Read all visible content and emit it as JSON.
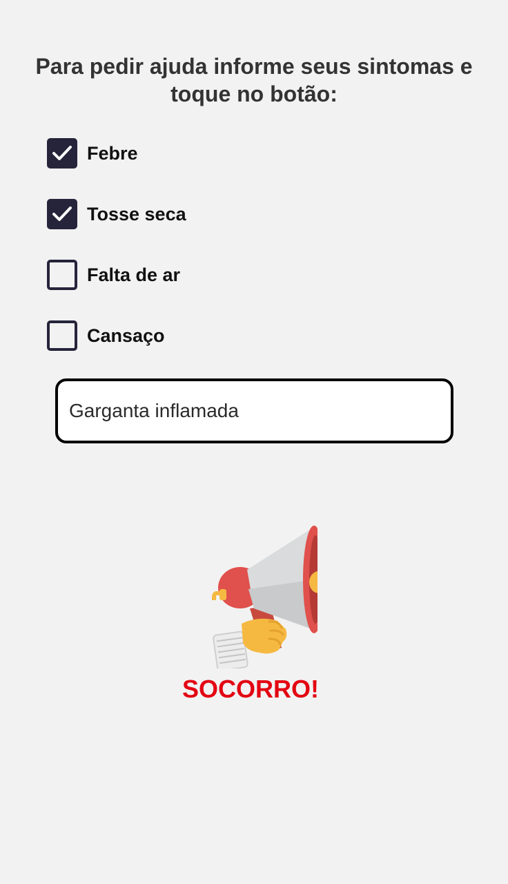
{
  "header": {
    "instructions": "Para pedir ajuda informe seus sintomas e toque no botão:"
  },
  "symptoms": [
    {
      "label": "Febre",
      "checked": true
    },
    {
      "label": "Tosse seca",
      "checked": true
    },
    {
      "label": "Falta de ar",
      "checked": false
    },
    {
      "label": "Cansaço",
      "checked": false
    }
  ],
  "other_symptom": {
    "value": "Garganta inflamada"
  },
  "help_button": {
    "label": "SOCORRO!",
    "icon": "megaphone-icon"
  },
  "colors": {
    "background": "#f2f2f2",
    "checkbox": "#25243a",
    "help_label": "#e30613",
    "megaphone_red": "#e0504c",
    "megaphone_grey": "#d9dbdc",
    "megaphone_yellow": "#f5b942"
  }
}
